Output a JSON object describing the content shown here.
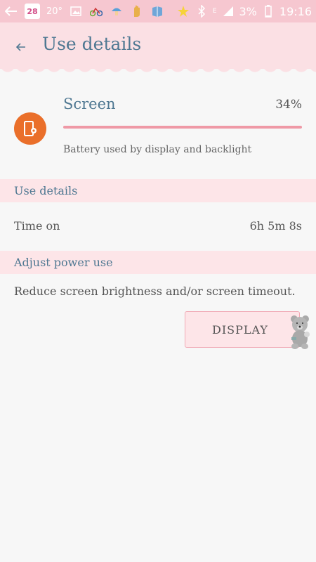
{
  "status_bar": {
    "calendar_day": "28",
    "temperature": "20°",
    "network": "E",
    "battery": "3%",
    "time": "19:16"
  },
  "header": {
    "title": "Use details"
  },
  "screen_card": {
    "title": "Screen",
    "percent": "34%",
    "usage_fraction": 1.0,
    "description": "Battery used by display and backlight"
  },
  "use_details": {
    "header": "Use details",
    "time_on_label": "Time on",
    "time_on_value": "6h 5m 8s"
  },
  "adjust_power": {
    "header": "Adjust power use",
    "advice": "Reduce screen brightness and/or screen timeout.",
    "button_label": "DISPLAY"
  },
  "colors": {
    "accent": "#4f7892",
    "status_bar": "#f6c7d0",
    "section_bg": "#fde5e8",
    "icon_bg": "#ea6f2a",
    "bar_fill": "#ef99a6"
  }
}
